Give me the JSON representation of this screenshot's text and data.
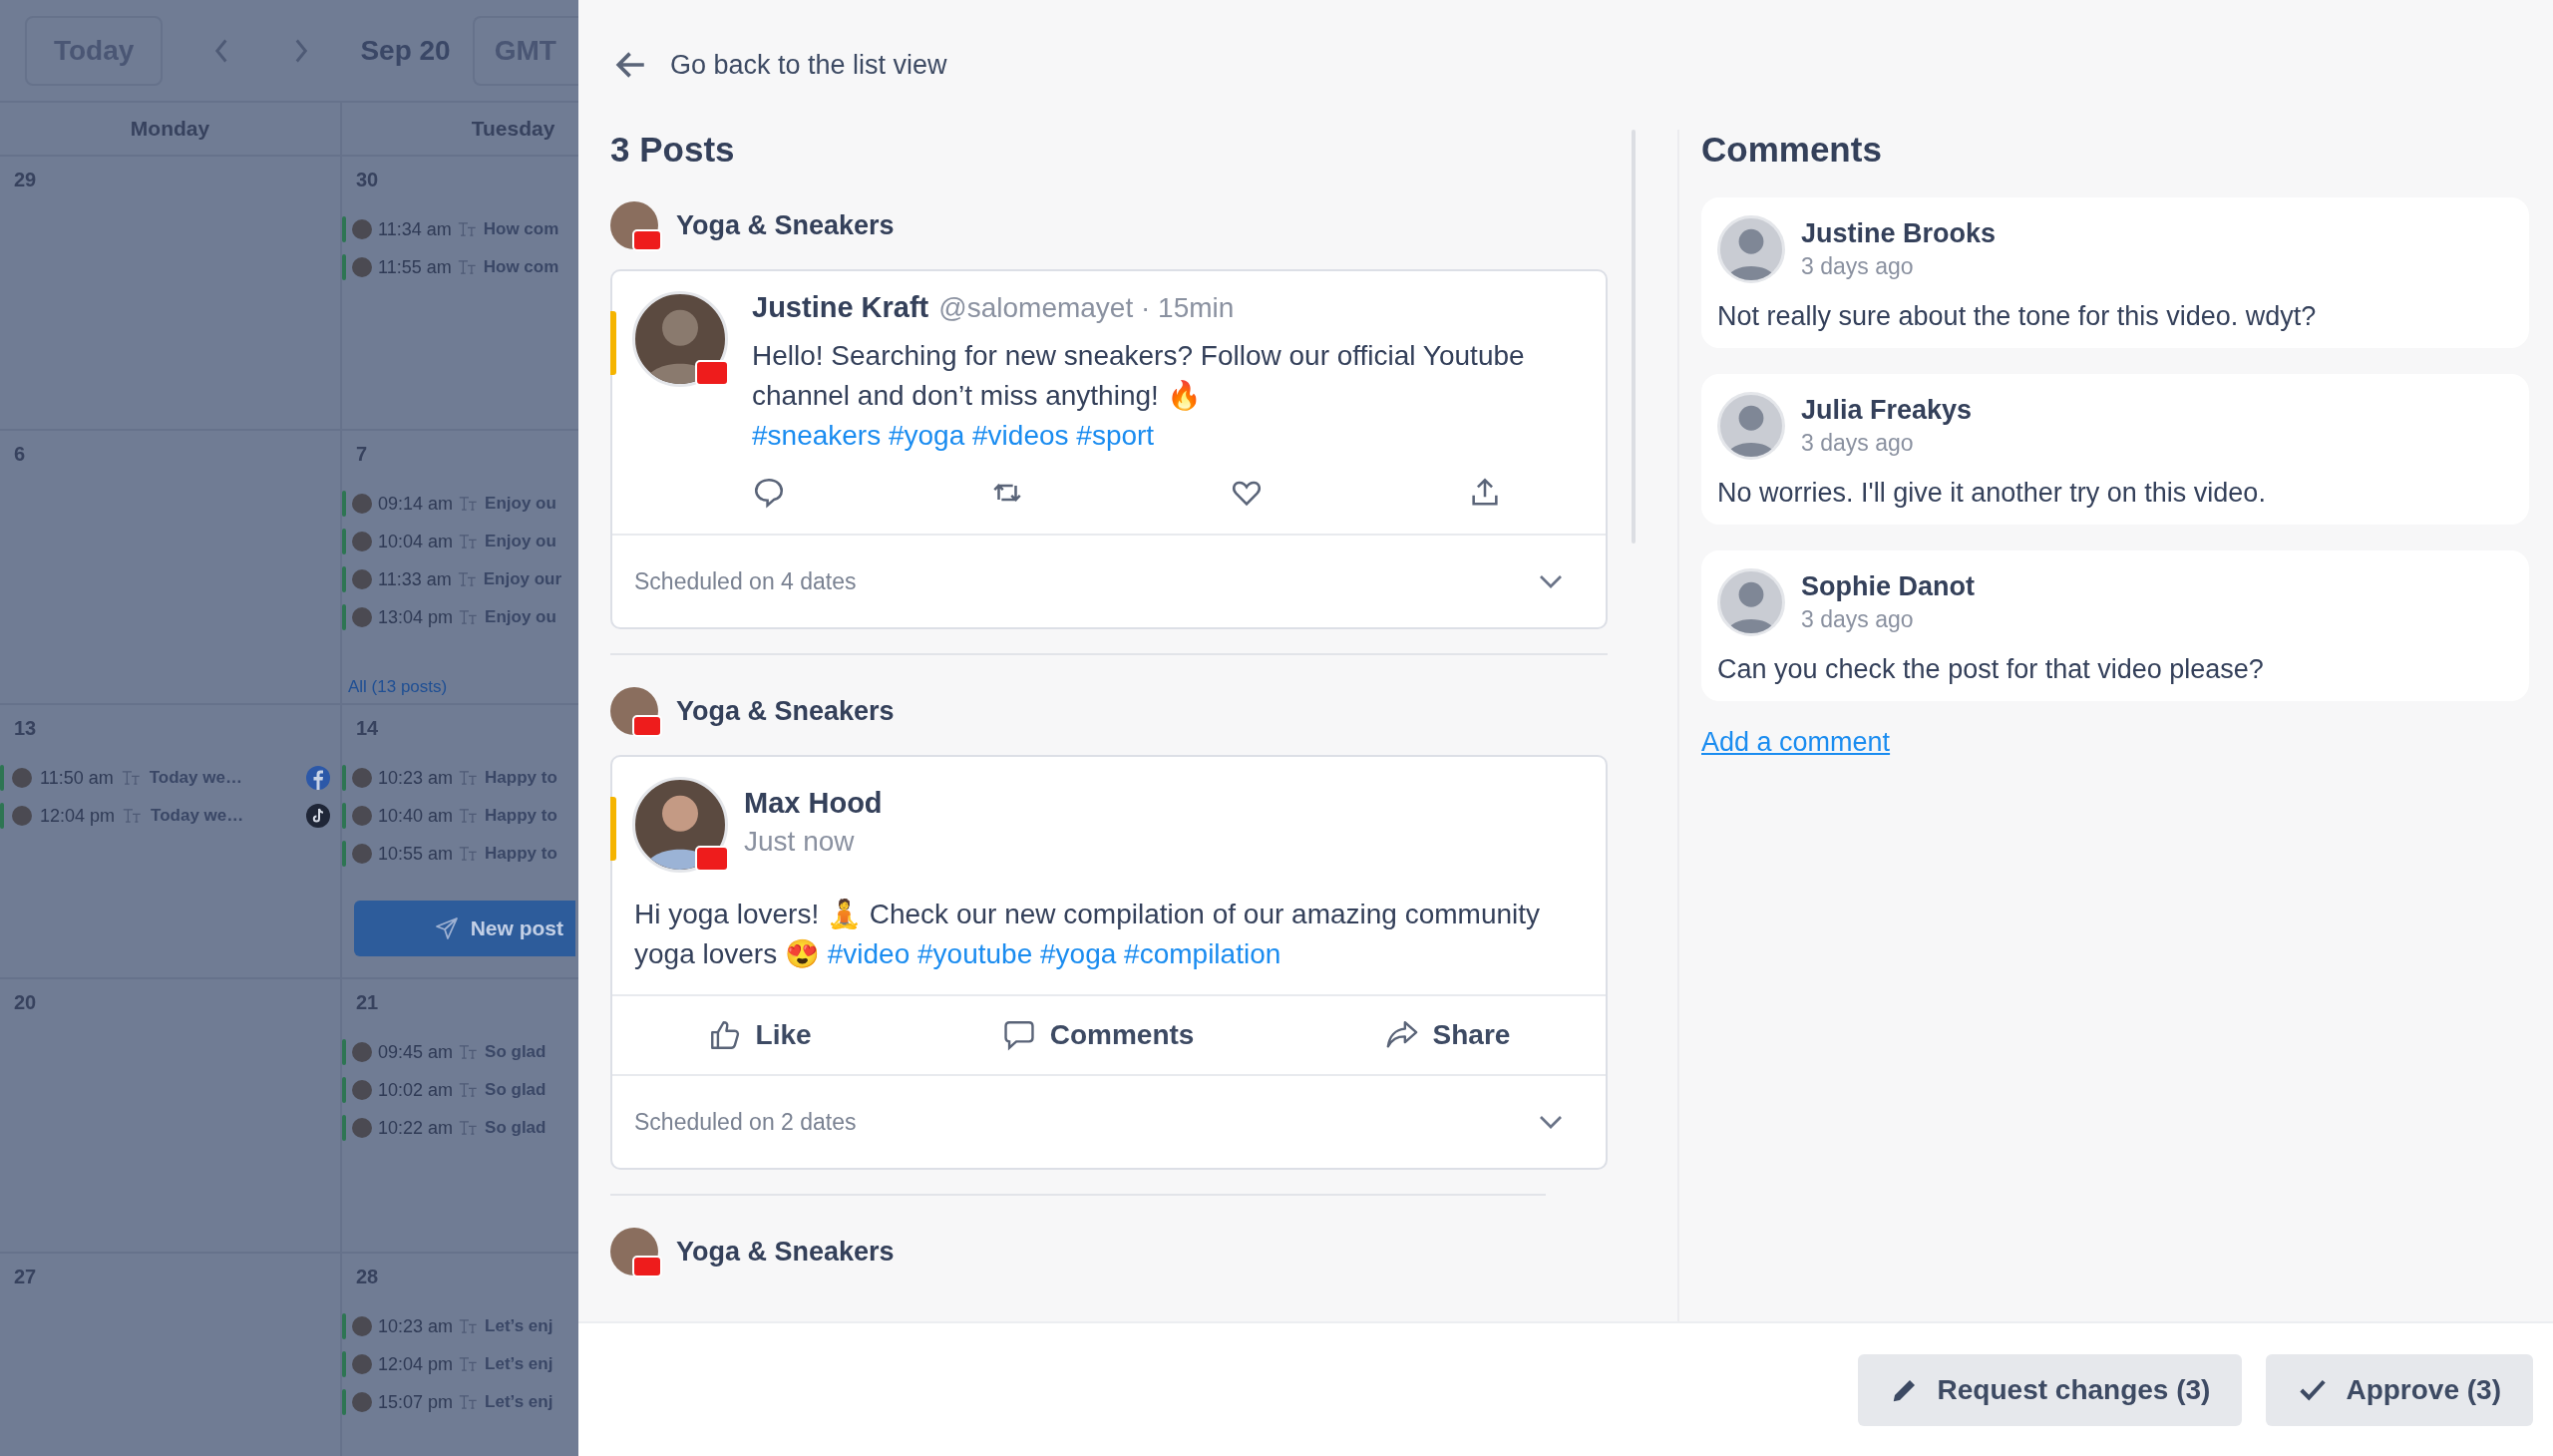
{
  "calendar": {
    "toolbar": {
      "today": "Today",
      "date": "Sep 20",
      "timezone": "GMT"
    },
    "day_headers": [
      "Monday",
      "Tuesday"
    ],
    "weeks": [
      {
        "days": [
          {
            "number": "29"
          },
          {
            "number": "30",
            "events": [
              {
                "time": "11:34 am",
                "text": "How com"
              },
              {
                "time": "11:55 am",
                "text": "How com"
              }
            ]
          }
        ]
      },
      {
        "days": [
          {
            "number": "6"
          },
          {
            "number": "7",
            "events": [
              {
                "time": "09:14 am",
                "text": "Enjoy ou"
              },
              {
                "time": "10:04 am",
                "text": "Enjoy ou"
              },
              {
                "time": "11:33 am",
                "text": "Enjoy our"
              },
              {
                "time": "13:04 pm",
                "text": "Enjoy ou"
              }
            ],
            "more_link": "All (13 posts)"
          }
        ]
      },
      {
        "days": [
          {
            "number": "13",
            "events": [
              {
                "time": "11:50 am",
                "text": "Today we…",
                "kind": "facebook"
              },
              {
                "time": "12:04 pm",
                "text": "Today we…",
                "kind": "tiktok"
              }
            ]
          },
          {
            "number": "14",
            "events": [
              {
                "time": "10:23 am",
                "text": "Happy to"
              },
              {
                "time": "10:40 am",
                "text": "Happy to"
              },
              {
                "time": "10:55 am",
                "text": "Happy to"
              }
            ],
            "new_post_button": "New post"
          }
        ]
      },
      {
        "days": [
          {
            "number": "20"
          },
          {
            "number": "21",
            "events": [
              {
                "time": "09:45 am",
                "text": "So glad"
              },
              {
                "time": "10:02 am",
                "text": "So glad"
              },
              {
                "time": "10:22 am",
                "text": "So glad"
              }
            ]
          }
        ]
      },
      {
        "days": [
          {
            "number": "27"
          },
          {
            "number": "28",
            "events": [
              {
                "time": "10:23 am",
                "text": "Let’s enj"
              },
              {
                "time": "12:04 pm",
                "text": "Let’s enj"
              },
              {
                "time": "15:07 pm",
                "text": "Let’s enj"
              }
            ]
          }
        ]
      }
    ]
  },
  "back_link": "Go back to the list view",
  "posts_title": "3 Posts",
  "posts": [
    {
      "account": "Yoga & Sneakers",
      "kind": "twitter",
      "author": "Justine Kraft",
      "meta": "@salomemayet · 15min",
      "text": "Hello! Searching for new sneakers? Follow our official Youtube channel and don’t miss anything! 🔥",
      "hashtags": "#sneakers #yoga #videos #sport",
      "schedule": "Scheduled on 4 dates"
    },
    {
      "account": "Yoga & Sneakers",
      "kind": "facebook",
      "author": "Max Hood",
      "meta": "Just now",
      "text": "Hi yoga lovers! 🧘 Check our new compilation of our amazing community yoga lovers 😍",
      "hashtags": "#video #youtube #yoga #compilation",
      "actions": [
        "Like",
        "Comments",
        "Share"
      ],
      "schedule": "Scheduled on 2 dates"
    },
    {
      "account": "Yoga & Sneakers",
      "kind": "collapsed"
    }
  ],
  "comments_title": "Comments",
  "comments": [
    {
      "name": "Justine Brooks",
      "time": "3 days ago",
      "text": "Not really sure about the tone for this video. wdyt?"
    },
    {
      "name": "Julia Freakys",
      "time": "3 days ago",
      "text": "No worries. I'll give it another try on this video."
    },
    {
      "name": "Sophie Danot",
      "time": "3 days ago",
      "text": "Can you check the post for that video please?"
    }
  ],
  "add_comment": "Add a comment",
  "footer_buttons": [
    {
      "label": "Request changes (3)",
      "kind": "edit"
    },
    {
      "label": "Approve (3)",
      "kind": "approve"
    }
  ]
}
